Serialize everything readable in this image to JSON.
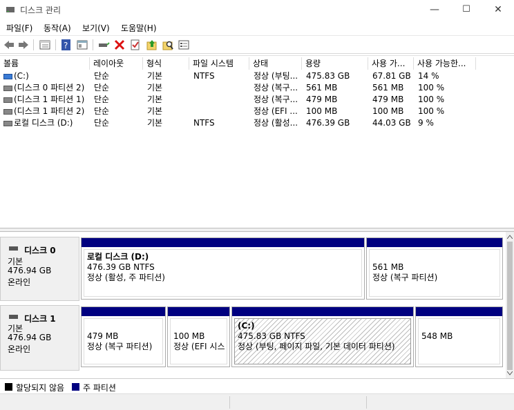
{
  "window": {
    "title": "디스크 관리",
    "min_glyph": "—",
    "max_glyph": "☐",
    "close_glyph": "✕"
  },
  "menu": [
    "파일(F)",
    "동작(A)",
    "보기(V)",
    "도움말(H)"
  ],
  "toolbar_icons": [
    "back-icon",
    "forward-icon",
    "list-view-icon",
    "help-icon",
    "properties-icon",
    "connect-icon",
    "delete-icon",
    "check-icon",
    "up-icon",
    "search-icon",
    "console-icon"
  ],
  "list": {
    "headers": [
      "볼륨",
      "레이아웃",
      "형식",
      "파일 시스템",
      "상태",
      "용량",
      "사용 가...",
      "사용 가능한..."
    ],
    "rows": [
      [
        "(C:)",
        "단순",
        "기본",
        "NTFS",
        "정상 (부팅...",
        "475.83 GB",
        "67.81 GB",
        "14 %"
      ],
      [
        "(디스크 0 파티션 2)",
        "단순",
        "기본",
        "",
        "정상 (복구...",
        "561 MB",
        "561 MB",
        "100 %"
      ],
      [
        "(디스크 1 파티션 1)",
        "단순",
        "기본",
        "",
        "정상 (복구...",
        "479 MB",
        "479 MB",
        "100 %"
      ],
      [
        "(디스크 1 파티션 2)",
        "단순",
        "기본",
        "",
        "정상 (EFI ...",
        "100 MB",
        "100 MB",
        "100 %"
      ],
      [
        "로컬 디스크 (D:)",
        "단순",
        "기본",
        "NTFS",
        "정상 (활성...",
        "476.39 GB",
        "44.03 GB",
        "9 %"
      ]
    ]
  },
  "disks": [
    {
      "name": "디스크 0",
      "type": "기본",
      "size": "476.94 GB",
      "status": "온라인",
      "parts": [
        {
          "title": "로컬 디스크  (D:)",
          "line1": "476.39 GB NTFS",
          "line2": "정상 (활성, 주 파티션)"
        },
        {
          "title": "",
          "line1": "561 MB",
          "line2": "정상 (복구 파티션)"
        }
      ]
    },
    {
      "name": "디스크 1",
      "type": "기본",
      "size": "476.94 GB",
      "status": "온라인",
      "parts": [
        {
          "title": "",
          "line1": "479 MB",
          "line2": "정상 (복구 파티션)"
        },
        {
          "title": "",
          "line1": "100 MB",
          "line2": "정상 (EFI 시스"
        },
        {
          "title": "(C:)",
          "line1": "475.83 GB NTFS",
          "line2": "정상 (부팅, 페이지 파일, 기본 데이터 파티션)"
        },
        {
          "title": "",
          "line1": "548 MB",
          "line2": ""
        }
      ]
    }
  ],
  "legend": {
    "unallocated": "할당되지 않음",
    "primary": "주 파티션",
    "unallocated_color": "#000000",
    "primary_color": "#000080"
  }
}
